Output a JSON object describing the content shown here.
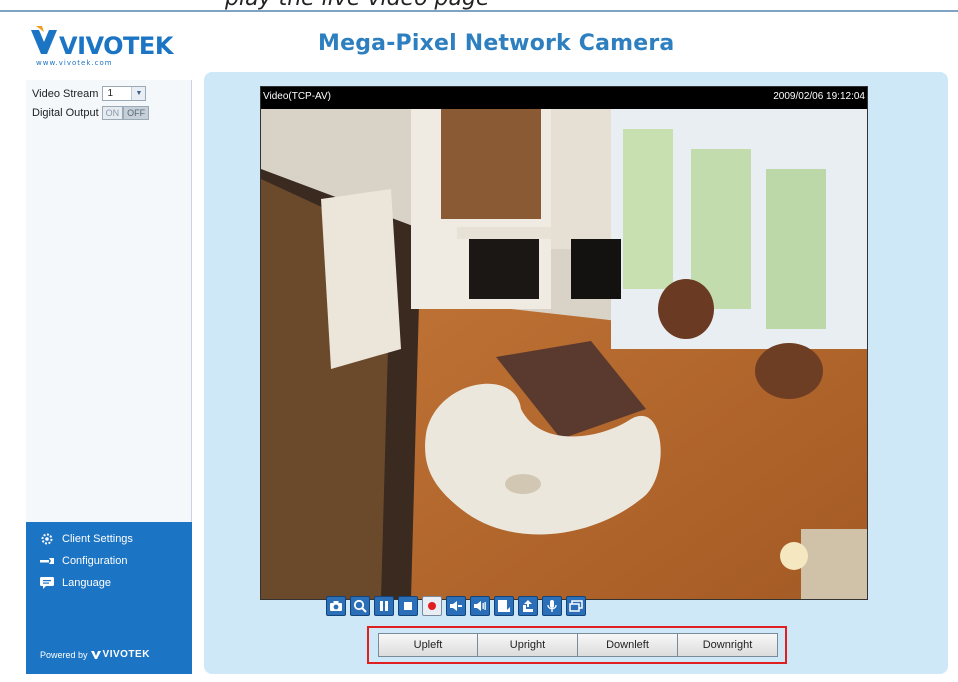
{
  "header": {
    "cut_text": "play the live video page",
    "brand": "VIVOTEK",
    "brand_url": "www.vivotek.com",
    "title": "Mega-Pixel Network Camera"
  },
  "sidebar": {
    "video_stream_label": "Video Stream",
    "video_stream_value": "1",
    "digital_output_label": "Digital Output",
    "do_on": "ON",
    "do_off": "OFF",
    "links": [
      {
        "label": "Client Settings",
        "icon": "gear-icon"
      },
      {
        "label": "Configuration",
        "icon": "wrench-icon"
      },
      {
        "label": "Language",
        "icon": "speech-bubble-icon"
      }
    ],
    "powered_by": "Powered by",
    "powered_brand": "VIVOTEK"
  },
  "video": {
    "protocol": "Video(TCP-AV)",
    "timestamp": "2009/02/06 19:12:04"
  },
  "toolbar": {
    "icons": [
      "snapshot-icon",
      "digital-zoom-icon",
      "pause-icon",
      "stop-icon",
      "record-icon",
      "volume-mute-icon",
      "volume-icon",
      "fullscreen-icon",
      "talk-icon",
      "microphone-icon",
      "view-size-icon"
    ]
  },
  "ptz": {
    "buttons": [
      "Upleft",
      "Upright",
      "Downleft",
      "Downright"
    ]
  },
  "colors": {
    "accent": "#1c74c4",
    "title": "#2d7fc0",
    "panel": "#cfe8f8",
    "highlight": "#e02020"
  }
}
